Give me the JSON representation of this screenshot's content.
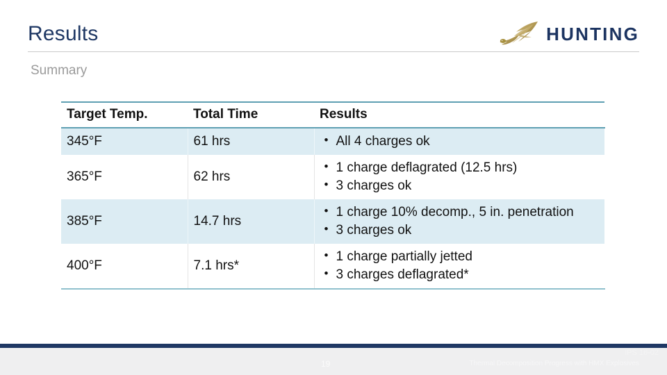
{
  "header": {
    "title": "Results",
    "subtitle": "Summary"
  },
  "logo": {
    "wordmark": "HUNTING",
    "bird_icon": "falcon-bird-icon",
    "bird_color": "#b9a05c",
    "text_color": "#1c3461"
  },
  "colors": {
    "title_navy": "#1f3864",
    "subtitle_gray": "#9a9a9a",
    "table_rule_teal": "#5e9fb2",
    "row_shade_blue": "#dcecf3",
    "footer_bar_navy": "#1f3864",
    "footer_bg_gray": "#efeff0"
  },
  "table": {
    "columns": [
      "Target Temp.",
      "Total Time",
      "Results"
    ],
    "rows": [
      {
        "target_temp": "345°F",
        "total_time": "61 hrs",
        "results": [
          "All 4 charges ok"
        ],
        "shaded": true
      },
      {
        "target_temp": "365°F",
        "total_time": "62 hrs",
        "results": [
          "1 charge deflagrated (12.5 hrs)",
          "3 charges ok"
        ],
        "shaded": false
      },
      {
        "target_temp": "385°F",
        "total_time": "14.7 hrs",
        "results": [
          "1 charge 10% decomp., 5 in. penetration",
          "3 charges ok"
        ],
        "shaded": true
      },
      {
        "target_temp": "400°F",
        "total_time": "7.1 hrs*",
        "results": [
          "1 charge partially jetted",
          "3 charges deflagrated*"
        ],
        "shaded": false
      }
    ]
  },
  "footer": {
    "page_number": "19",
    "code": "IPS 16-02",
    "caption": "Thermal Decomposition Progress with HMX Explosives"
  }
}
